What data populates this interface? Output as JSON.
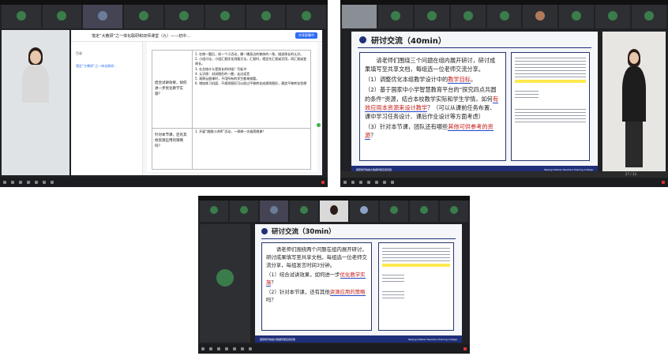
{
  "screenshot1": {
    "doc_title": "落定“大教研”之一体化联研和双师课堂（九）——初中...",
    "sidebar_label": "目录",
    "sidebar_link": "落定“大教研”之一体化联研...",
    "row1_question": "结合试讲效果，如何进一步优化教学实施？",
    "row1_answers": [
      "1. 在做一题后，如一个小活动，播一播身边的物体的一角，描述周长的认识。",
      "2. 小组讨论，小组汇报优化测量方法，汇报时，规定先汇报或活用，再汇报或变周长。",
      "3. 在总结什么是周长的时候？写板书",
      "4. 认识周：封闭图形的一圈，走边读音",
      "5. 观察云图课时，不用所有的学生都来描看。",
      "6. 增加练习巩固，不规则图形可以经过平移转化成规则图形，建造平移转化思想"
    ],
    "row2_question": "针对本节课，还有其他资源应用的策略吗？",
    "row2_answers": [
      "1. 开展“跳跳小讲师”活动，一周做一次极简微课？"
    ],
    "share_button": "共享屏幕中",
    "meeting_button": "会议"
  },
  "screenshot2": {
    "title": "研讨交流（40min）",
    "paragraphs": [
      {
        "text": "请老师们围绕三个问题在组内展开研讨，研讨成果填写至共享文档，每组选一位老师交流分享。",
        "highlight": ""
      },
      {
        "prefix": "（1）调整优化本组教学设计中的",
        "highlight": "教学目标",
        "suffix": "。"
      },
      {
        "prefix": "（2）基于国家中小学智慧教育平台的“探究四点共圆的条件”资源，结合本校教学实际和学生学情，如何",
        "highlight": "有效应用本资源来设计教学",
        "suffix": "？（可以从课前任务布置、课中学习任务设计、课后作业设计等方面考虑）"
      },
      {
        "prefix": "（3）针对本节课，团队还有哪些",
        "highlight": "其他可供参考的资源",
        "suffix": "？"
      }
    ],
    "footer_left": "国家教育统编大数据智能应用实践",
    "footer_right": "Beijing Haidian Teachers Training College",
    "page_number": "27 / 33"
  },
  "screenshot3": {
    "title": "研讨交流（30min）",
    "paragraphs": [
      {
        "text": "请老师们围绕两个问题在组内展开研讨，研讨成果填写至共享文档，每组选一位老师交流分享，每组发言时间3分钟。",
        "highlight": ""
      },
      {
        "prefix": "（1）结合试讲效果，如何进一步",
        "highlight": "优化教学实施",
        "suffix": "？"
      },
      {
        "prefix": "（2）针对本节课，还有其他",
        "highlight": "资源应用的策略",
        "suffix": "吗？"
      }
    ],
    "footer_left": "国家教育统编大数据智能应用实践",
    "footer_right": "Beijing Haidian Teachers Training College"
  }
}
